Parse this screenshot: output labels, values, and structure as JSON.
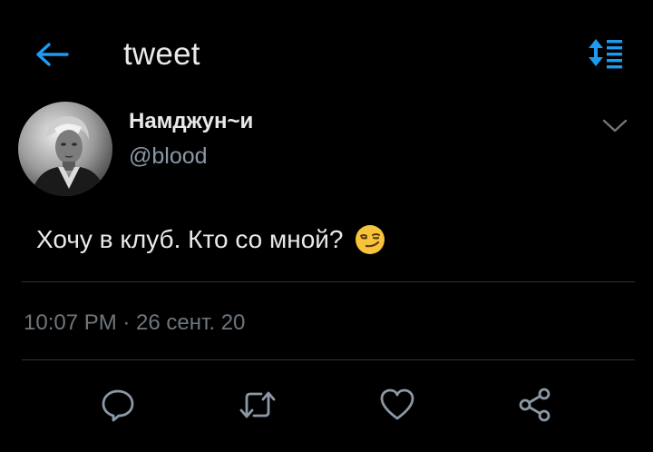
{
  "header": {
    "title": "tweet",
    "back_icon": "arrow-left-icon",
    "filter_icon": "sort-filter-icon",
    "accent_color": "#1d9bf0"
  },
  "tweet": {
    "author_name": "Намджун~и",
    "author_handle": "@blood",
    "text": "Хочу в клуб. Кто со мной?",
    "emoji": "smirking-face-emoji",
    "timestamp": "10:07 PM · 26 сент. 20"
  },
  "actions": {
    "reply_icon": "reply-icon",
    "retweet_icon": "retweet-icon",
    "like_icon": "like-heart-icon",
    "share_icon": "share-icon"
  }
}
